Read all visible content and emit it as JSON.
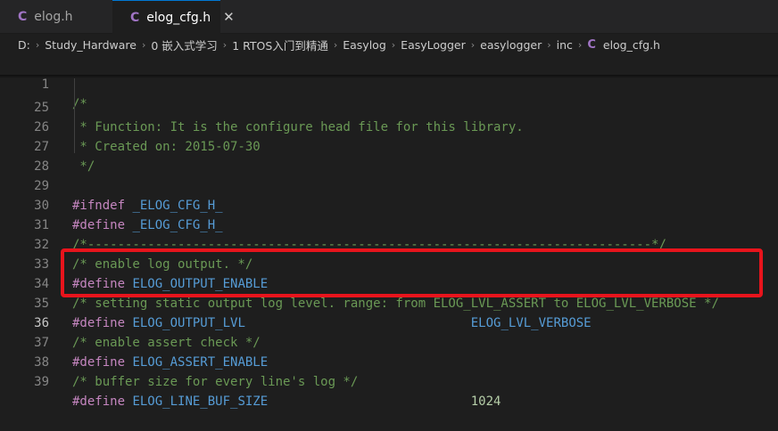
{
  "tabs": [
    {
      "icon": "C",
      "label": "elog.h",
      "active": false
    },
    {
      "icon": "C",
      "label": "elog_cfg.h",
      "active": true,
      "close": "✕"
    }
  ],
  "breadcrumb": {
    "items": [
      "D:",
      "Study_Hardware",
      "0 嵌入式学习",
      "1 RTOS入门到精通",
      "Easylog",
      "EasyLogger",
      "easylogger",
      "inc"
    ],
    "file_icon": "C",
    "file": "elog_cfg.h",
    "separator": "›"
  },
  "editor": {
    "lines": [
      {
        "num": "1",
        "code": "/*"
      },
      {
        "num": "25",
        "code": " * Function: It is the configure head file for this library."
      },
      {
        "num": "26",
        "code": " * Created on: 2015-07-30"
      },
      {
        "num": "27",
        "code": " */"
      },
      {
        "num": "28",
        "code": ""
      },
      {
        "num": "29",
        "kw": "#ifndef",
        "name": " _ELOG_CFG_H_"
      },
      {
        "num": "30",
        "kw": "#define",
        "name": " _ELOG_CFG_H_"
      },
      {
        "num": "31",
        "code": "/*---------------------------------------------------------------------------*/"
      },
      {
        "num": "32",
        "code": "/* enable log output. */"
      },
      {
        "num": "33",
        "kw": "#define",
        "name": " ELOG_OUTPUT_ENABLE"
      },
      {
        "num": "34",
        "code": "/* setting static output log level. range: from ELOG_LVL_ASSERT to ELOG_LVL_VERBOSE */"
      },
      {
        "num": "35",
        "kw": "#define",
        "name": " ELOG_OUTPUT_LVL",
        "pad": "                              ",
        "value": "ELOG_LVL_VERBOSE"
      },
      {
        "num": "36",
        "code": "/* enable assert check */"
      },
      {
        "num": "37",
        "kw": "#define",
        "name": " ELOG_ASSERT_ENABLE"
      },
      {
        "num": "38",
        "code": "/* buffer size for every line's log */"
      },
      {
        "num": "39",
        "kw": "#define",
        "name": " ELOG_LINE_BUF_SIZE",
        "pad": "                           ",
        "value": "1024"
      }
    ]
  },
  "colors": {
    "comment": "#6a9955",
    "keyword": "#c586c0",
    "macro": "#569cd6",
    "number": "#b5cea8",
    "highlight_box": "#e8141c"
  }
}
